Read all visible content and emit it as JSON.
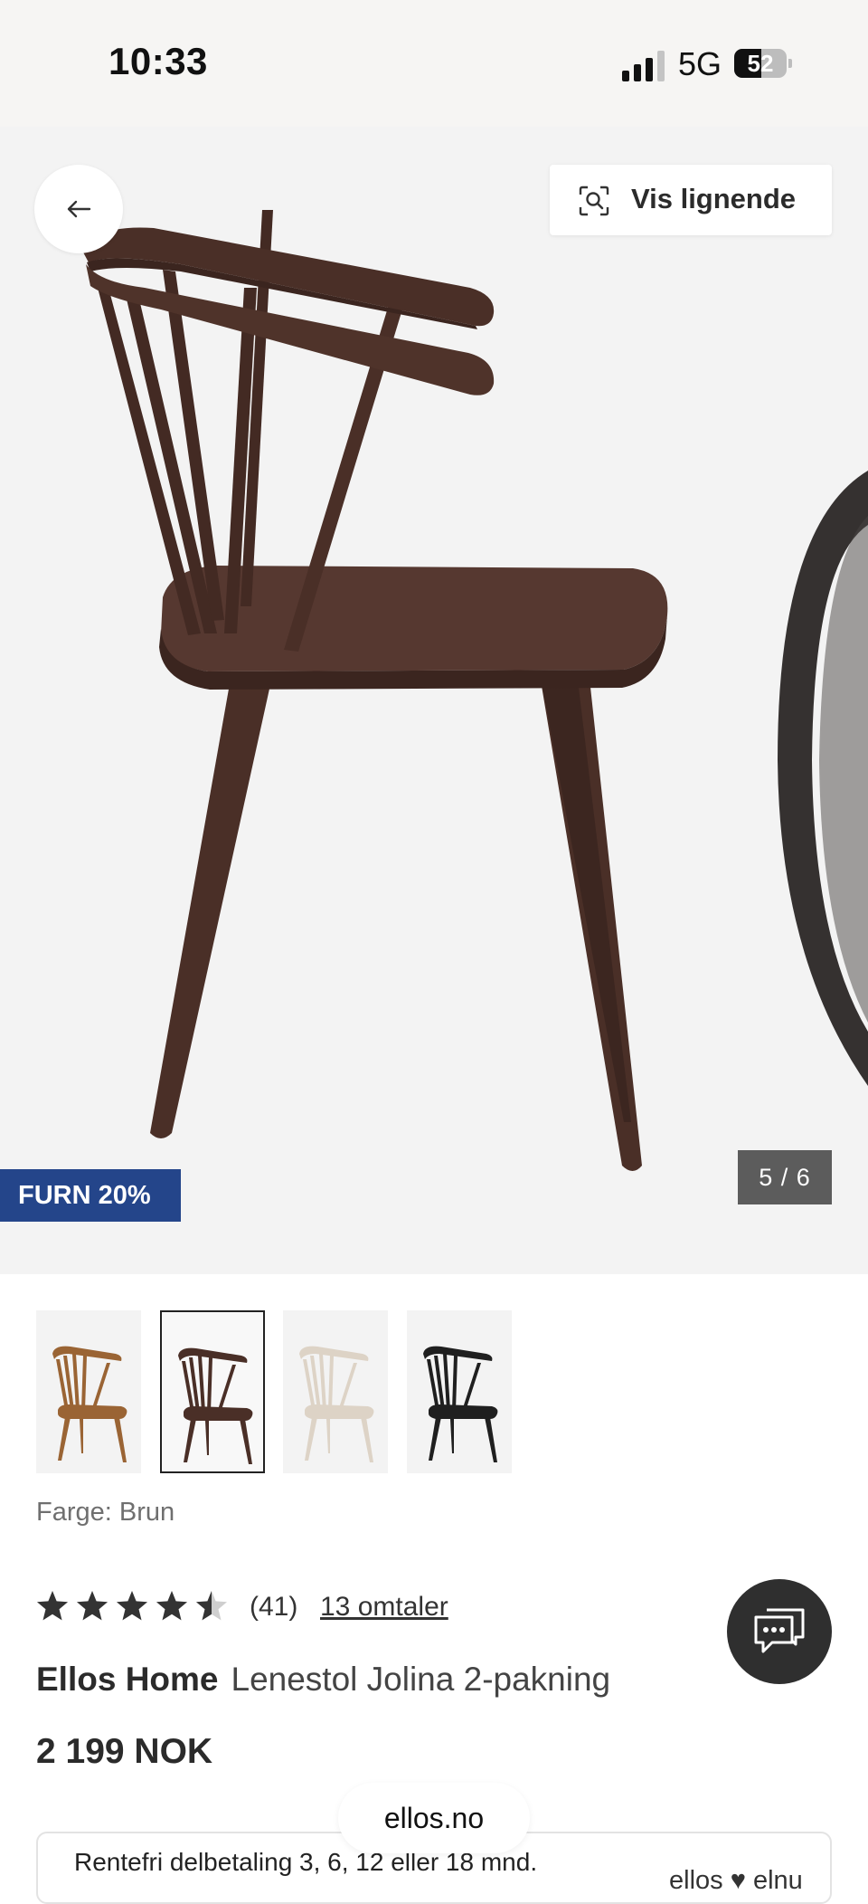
{
  "status_bar": {
    "time": "10:33",
    "network": "5G",
    "battery": "52",
    "battery_level": 0.52
  },
  "hero": {
    "similar_label": "Vis lignende",
    "promo_badge": "FURN 20%",
    "image_counter": "5 / 6",
    "icons": {
      "back": "arrow-left-icon",
      "similar": "visual-search-icon"
    }
  },
  "thumbnails": [
    {
      "color_name": "light-brown",
      "color": "#9a6434",
      "selected": false
    },
    {
      "color_name": "brown",
      "color": "#4a2f27",
      "selected": true
    },
    {
      "color_name": "white",
      "color": "#ddd3c6",
      "selected": false
    },
    {
      "color_name": "black",
      "color": "#1f1f1f",
      "selected": false
    }
  ],
  "product": {
    "color_label": "Farge: Brun",
    "rating": 4.5,
    "rating_count": "(41)",
    "reviews_link": "13 omtaler",
    "brand": "Ellos Home",
    "name": "Lenestol Jolina 2-pakning",
    "price": "2 199 NOK"
  },
  "installment": {
    "text": "Rentefri delbetaling 3, 6, 12 eller 18 mnd.",
    "partner": "ellos ♥ elnu"
  },
  "browser": {
    "domain": "ellos.no"
  },
  "chat": {
    "icon": "chat-icon"
  },
  "colors": {
    "brand_blue": "#24458a",
    "chair_wood": "#4a2f27",
    "counter_bg": "#5c5c5c",
    "chat_bg": "#2f2f2f"
  }
}
